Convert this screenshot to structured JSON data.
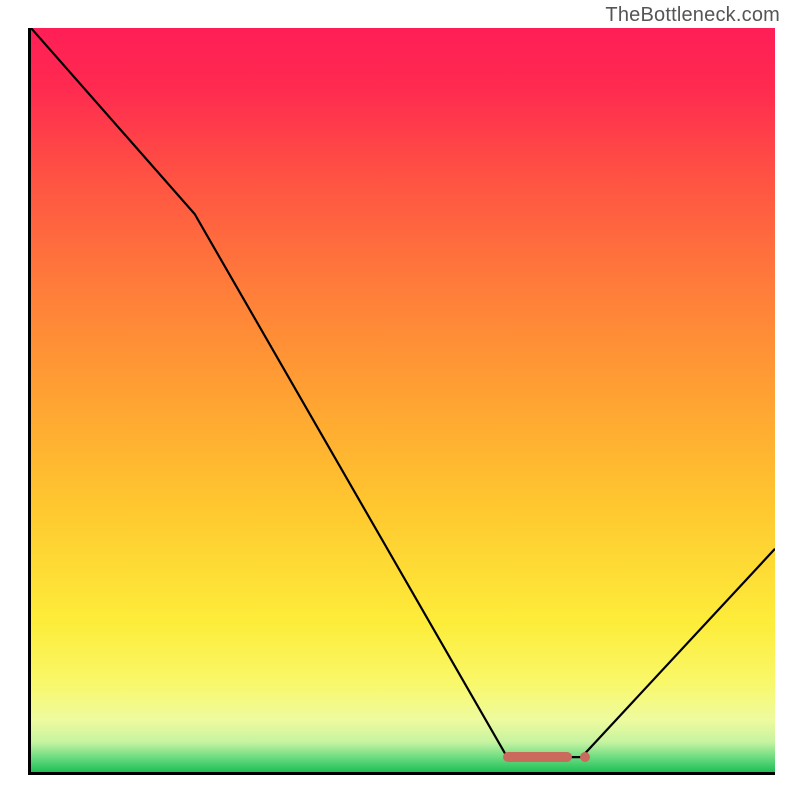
{
  "watermark": "TheBottleneck.com",
  "chart_data": {
    "type": "line",
    "title": "",
    "xlabel": "",
    "ylabel": "",
    "xlim": [
      0,
      100
    ],
    "ylim": [
      0,
      100
    ],
    "x": [
      0,
      22,
      64,
      74,
      100
    ],
    "values": [
      100,
      75,
      2,
      2,
      30
    ],
    "marker": {
      "x_start": 64,
      "x_end": 74,
      "y": 2
    },
    "background_gradient": [
      {
        "stop": 0.0,
        "color": "#ff1e56"
      },
      {
        "stop": 0.08,
        "color": "#ff2a50"
      },
      {
        "stop": 0.2,
        "color": "#ff5243"
      },
      {
        "stop": 0.35,
        "color": "#ff7d3a"
      },
      {
        "stop": 0.5,
        "color": "#ffa332"
      },
      {
        "stop": 0.65,
        "color": "#ffc92f"
      },
      {
        "stop": 0.8,
        "color": "#fded3a"
      },
      {
        "stop": 0.88,
        "color": "#f9f86a"
      },
      {
        "stop": 0.93,
        "color": "#eefb9e"
      },
      {
        "stop": 0.96,
        "color": "#c6f3a0"
      },
      {
        "stop": 0.98,
        "color": "#6edc82"
      },
      {
        "stop": 1.0,
        "color": "#1fbf56"
      }
    ]
  }
}
